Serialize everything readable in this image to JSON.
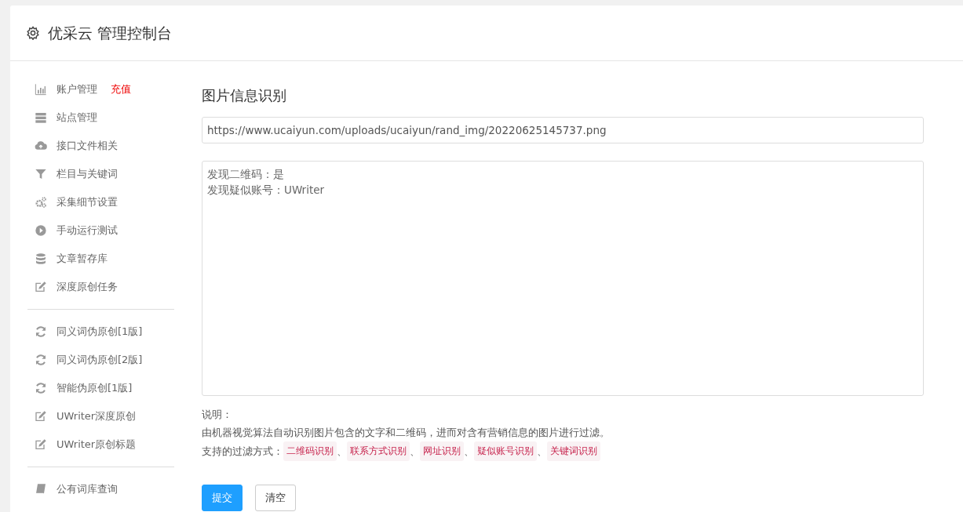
{
  "header": {
    "title": "优采云 管理控制台"
  },
  "menu_groups": [
    [
      {
        "label": "账户管理",
        "badge": "充值"
      },
      {
        "label": "站点管理"
      },
      {
        "label": "接口文件相关"
      },
      {
        "label": "栏目与关键词"
      },
      {
        "label": "采集细节设置"
      },
      {
        "label": "手动运行测试"
      },
      {
        "label": "文章暂存库"
      },
      {
        "label": "深度原创任务"
      }
    ],
    [
      {
        "label": "同义词伪原创[1版]"
      },
      {
        "label": "同义词伪原创[2版]"
      },
      {
        "label": "智能伪原创[1版]"
      },
      {
        "label": "UWriter深度原创"
      },
      {
        "label": "UWriter原创标题"
      }
    ],
    [
      {
        "label": "公有词库查询"
      }
    ]
  ],
  "main": {
    "title": "图片信息识别",
    "url_field": {
      "value": "https://www.ucaiyun.com/uploads/ucaiyun/rand_img/20220625145737.png"
    },
    "result_box": {
      "lines": [
        "发现二维码：是",
        "发现疑似账号：UWriter"
      ]
    },
    "note_label": "说明：",
    "note_text": "由机器视觉算法自动识别图片包含的文字和二维码，进而对含有营销信息的图片进行过滤。",
    "filters_label": "支持的过滤方式：",
    "filters": [
      "二维码识别",
      "联系方式识别",
      "网址识别",
      "疑似账号识别",
      "关键词识别"
    ],
    "filter_separator": "、",
    "buttons": [
      {
        "label": "提交",
        "kind": "primary"
      },
      {
        "label": "清空",
        "kind": "secondary"
      }
    ]
  }
}
